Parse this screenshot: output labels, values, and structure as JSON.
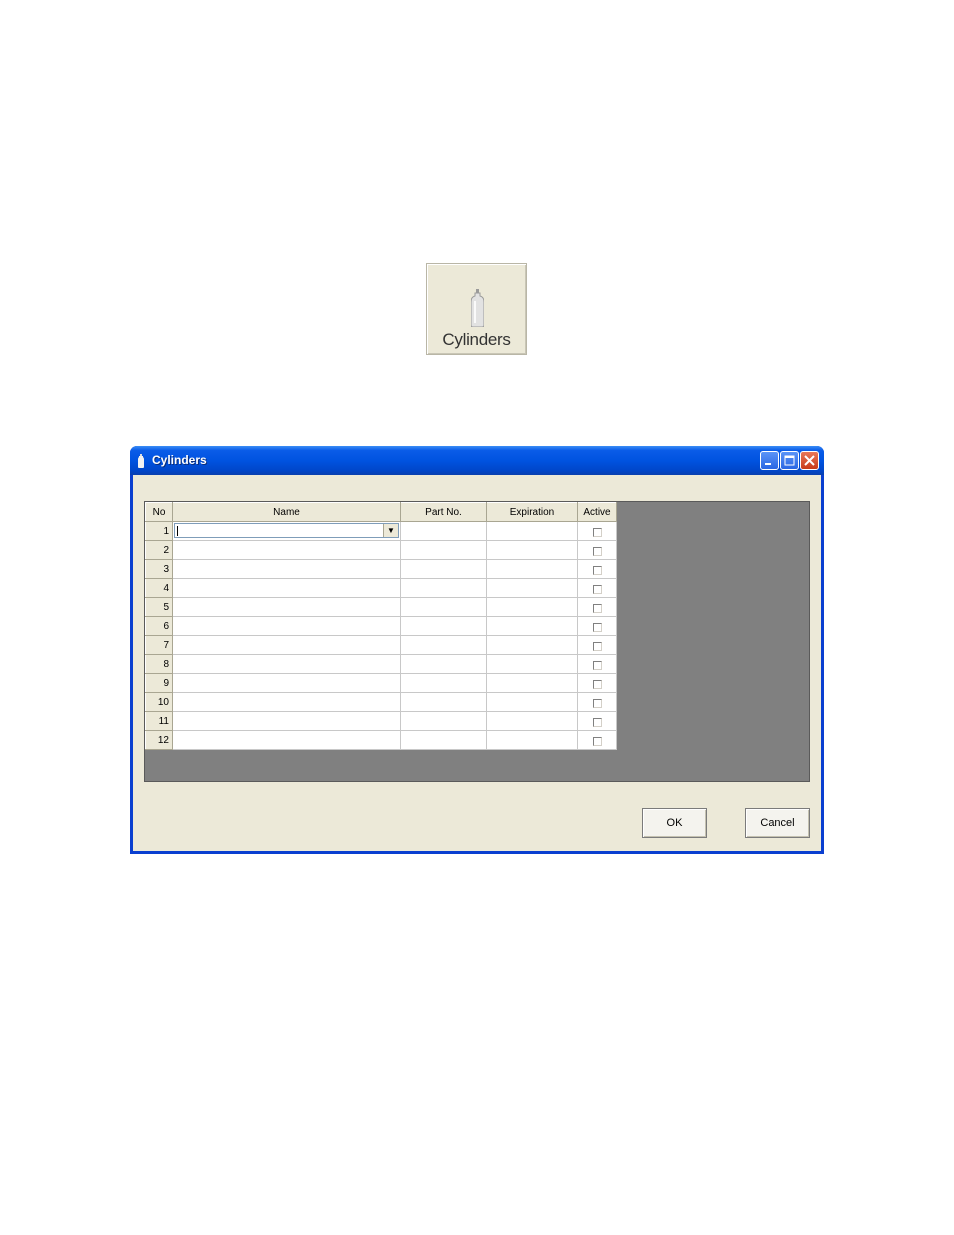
{
  "launcher": {
    "label": "Cylinders",
    "icon": "gas-cylinder-icon"
  },
  "window": {
    "title": "Cylinders",
    "title_icon": "gas-cylinder-icon",
    "controls": {
      "minimize_icon": "minimize-icon",
      "maximize_icon": "maximize-icon",
      "close_icon": "close-icon"
    }
  },
  "grid": {
    "columns": [
      "No",
      "Name",
      "Part No.",
      "Expiration",
      "Active"
    ],
    "rows": [
      {
        "no": "1"
      },
      {
        "no": "2"
      },
      {
        "no": "3"
      },
      {
        "no": "4"
      },
      {
        "no": "5"
      },
      {
        "no": "6"
      },
      {
        "no": "7"
      },
      {
        "no": "8"
      },
      {
        "no": "9"
      },
      {
        "no": "10"
      },
      {
        "no": "11"
      },
      {
        "no": "12"
      }
    ]
  },
  "buttons": {
    "ok": "OK",
    "cancel": "Cancel"
  },
  "colors": {
    "title_bar": "#0053e0",
    "client_bg": "#ece9d8",
    "grid_bg": "#808080"
  }
}
